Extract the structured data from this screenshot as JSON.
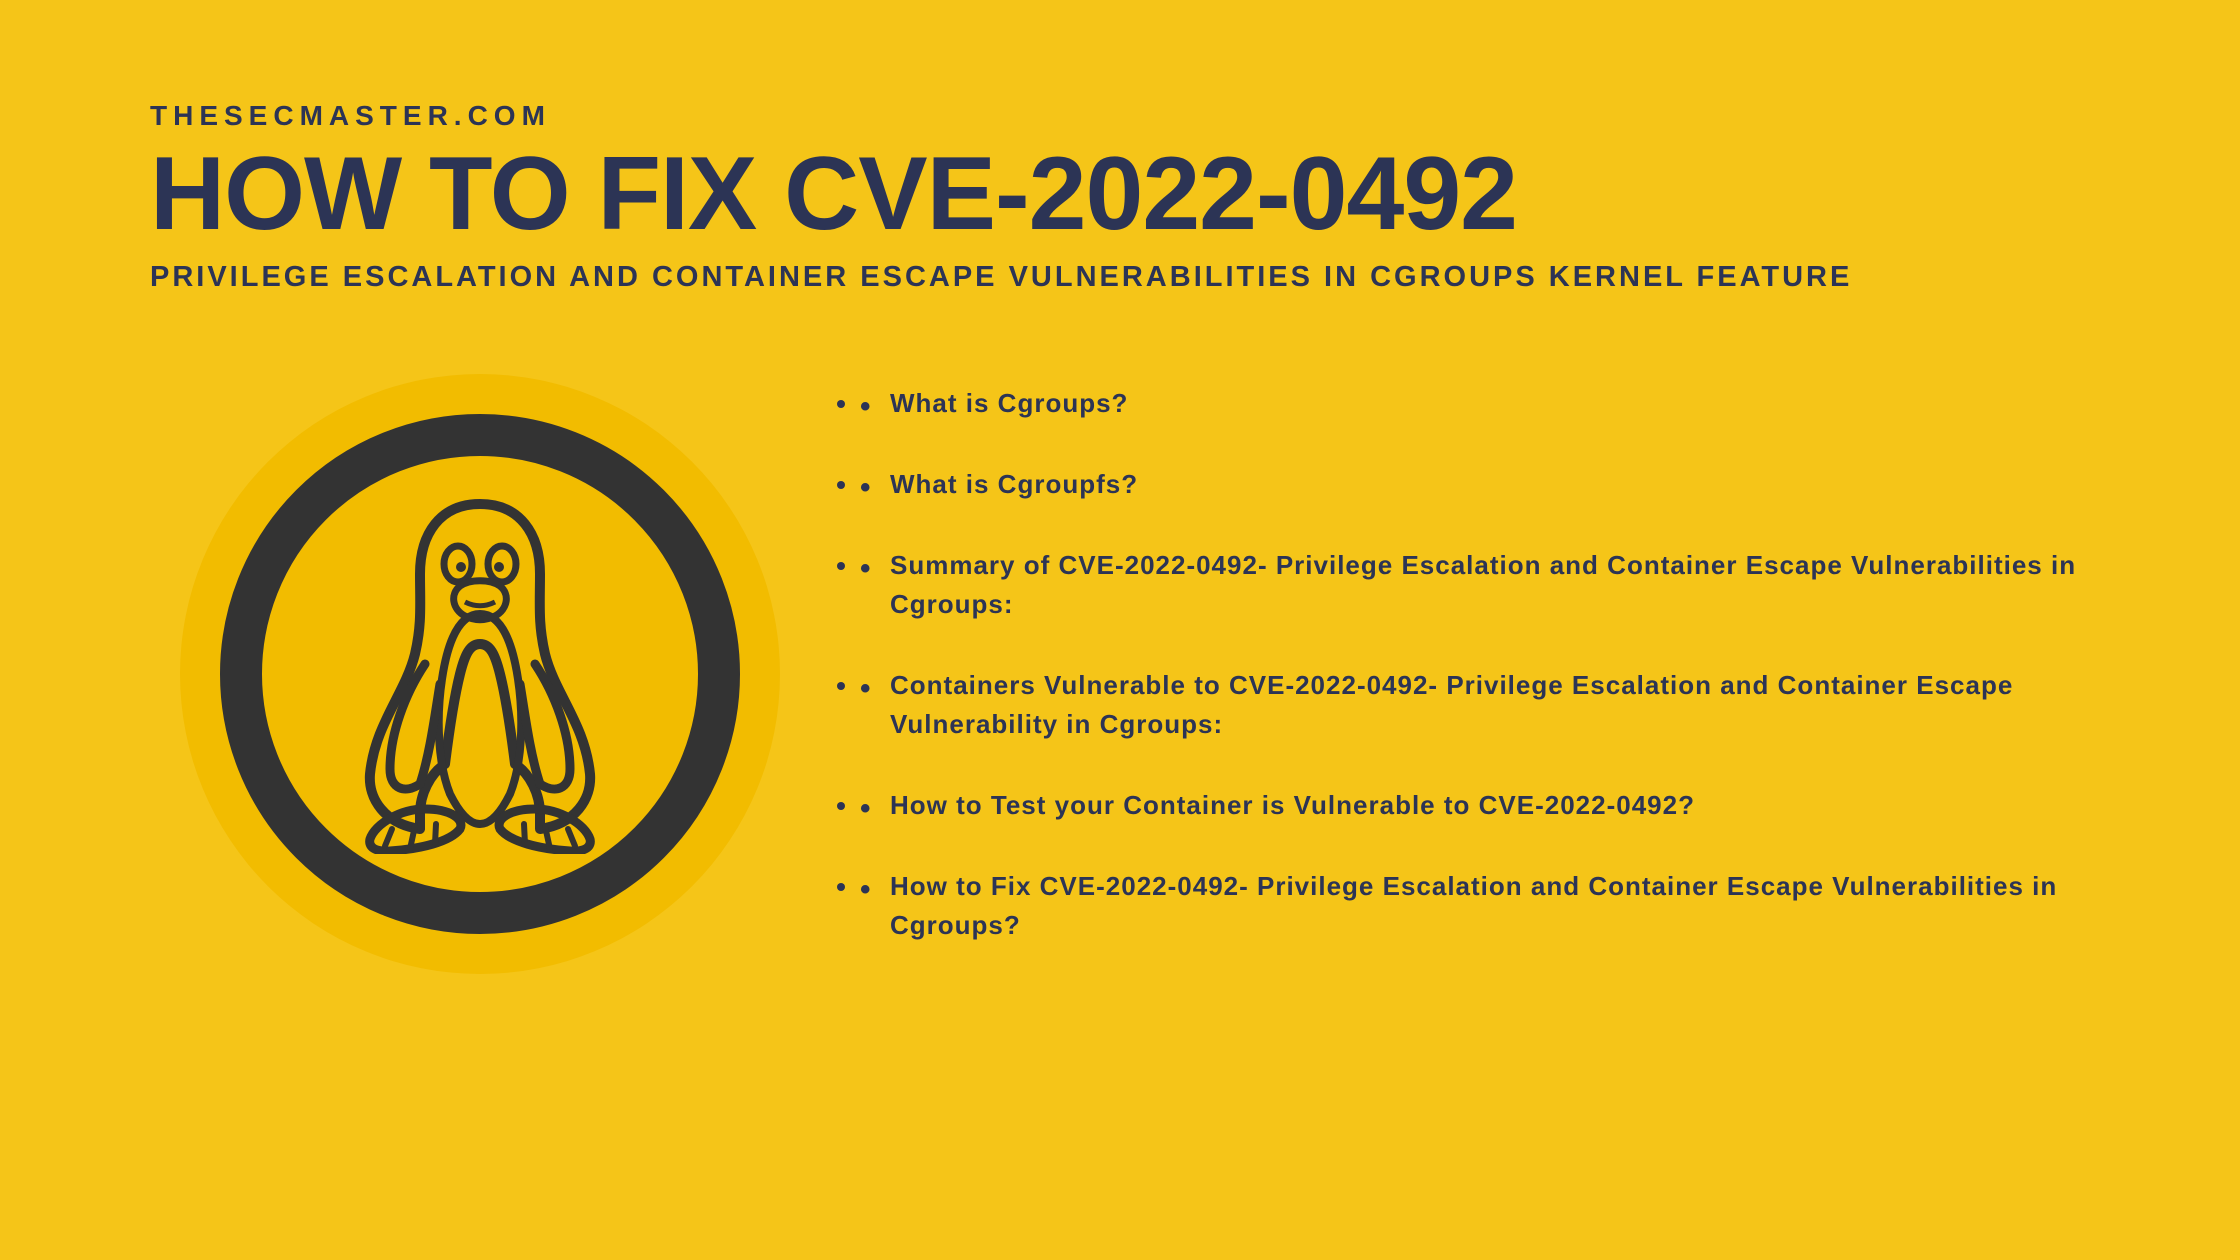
{
  "site": "THESECMASTER.COM",
  "title": "HOW TO FIX CVE-2022-0492",
  "subtitle": "PRIVILEGE ESCALATION AND CONTAINER ESCAPE VULNERABILITIES IN CGROUPS KERNEL FEATURE",
  "logo_icon_name": "linux-penguin-icon",
  "bullets": [
    "What is Cgroups?",
    "What is Cgroupfs?",
    "Summary of CVE-2022-0492- Privilege Escalation and Container Escape Vulnerabilities in Cgroups:",
    "Containers Vulnerable to CVE-2022-0492- Privilege Escalation and Container Escape Vulnerability in Cgroups:",
    "How to Test your Container is Vulnerable to CVE-2022-0492?",
    "How to Fix CVE-2022-0492- Privilege Escalation and Container Escape Vulnerabilities in Cgroups?"
  ]
}
